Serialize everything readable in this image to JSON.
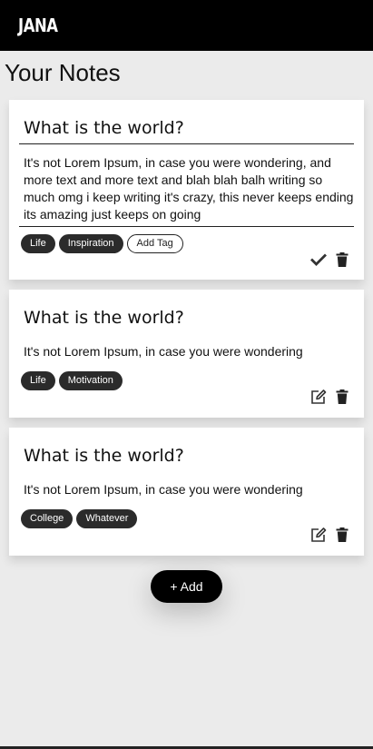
{
  "app": {
    "brand": "JANA"
  },
  "page": {
    "title": "Your Notes"
  },
  "notes": [
    {
      "title": "What is the world?",
      "body": "It's not Lorem Ipsum, in case you were wondering, and more text and more text and blah blah balh writing so much omg i keep writing it's crazy, this never keeps ending its amazing just keeps on going",
      "tags": [
        "Life",
        "Inspiration"
      ],
      "add_tag_label": "Add Tag",
      "mode": "editing",
      "icons": [
        "check-icon",
        "trash-icon"
      ]
    },
    {
      "title": "What is the world?",
      "body": "It's not Lorem Ipsum, in case you were wondering",
      "tags": [
        "Life",
        "Motivation"
      ],
      "mode": "view",
      "icons": [
        "edit-icon",
        "trash-icon"
      ]
    },
    {
      "title": "What is the world?",
      "body": "It's not Lorem Ipsum, in case you were wondering",
      "tags": [
        "College",
        "Whatever"
      ],
      "mode": "view",
      "icons": [
        "edit-icon",
        "trash-icon"
      ]
    }
  ],
  "add_button": {
    "label": "+ Add"
  },
  "colors": {
    "topbar": "#000000",
    "background": "#ebebeb",
    "tag": "#2b2b2b",
    "card": "#ffffff"
  }
}
